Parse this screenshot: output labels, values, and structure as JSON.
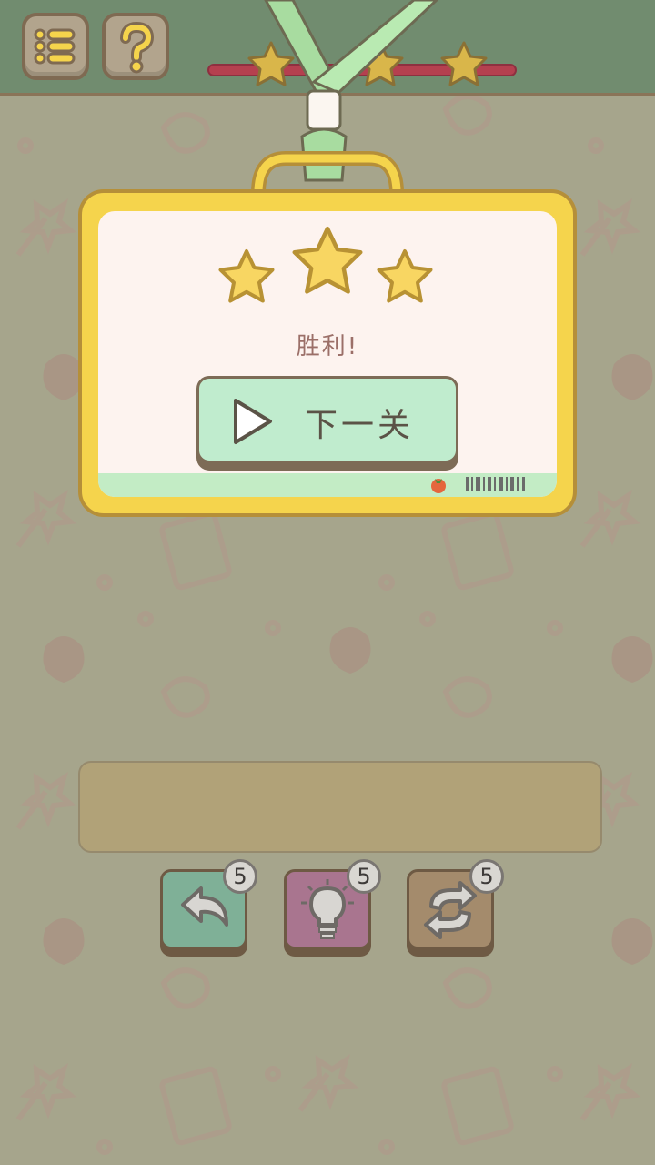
{
  "header": {
    "menu_icon": "list-menu-icon",
    "help_icon": "question-mark-icon",
    "progress_stars_earned": 3,
    "progress_stars_total": 3
  },
  "result_card": {
    "stars_earned": 3,
    "stars_total": 3,
    "message": "胜利!",
    "next_button_label": "下一关",
    "next_button_icon": "play-icon"
  },
  "tools": [
    {
      "name": "undo",
      "icon": "undo-arrow-icon",
      "count": "5",
      "color": "#7fb097"
    },
    {
      "name": "hint",
      "icon": "light-bulb-icon",
      "count": "5",
      "color": "#a9758f"
    },
    {
      "name": "shuffle",
      "icon": "shuffle-arrows-icon",
      "count": "5",
      "color": "#a48b6c"
    }
  ],
  "colors": {
    "background": "#a6a58c",
    "topbar": "#718c6f",
    "star": "#f6d05a",
    "badge_frame": "#f5d44c",
    "next_button": "#c0ecce",
    "answer_tray": "#b1a278"
  }
}
